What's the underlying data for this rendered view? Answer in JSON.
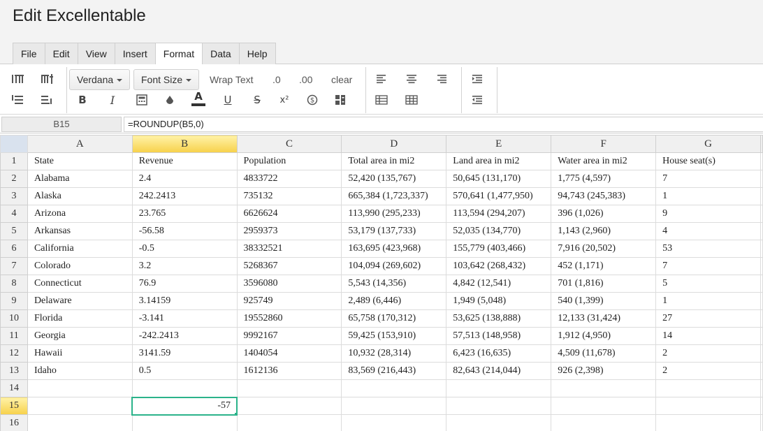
{
  "app": {
    "title": "Edit Excellentable"
  },
  "menu": {
    "tabs": [
      {
        "label": "File"
      },
      {
        "label": "Edit"
      },
      {
        "label": "View"
      },
      {
        "label": "Insert"
      },
      {
        "label": "Format"
      },
      {
        "label": "Data"
      },
      {
        "label": "Help"
      }
    ],
    "active": "Format"
  },
  "toolbar": {
    "font_family": "Verdana",
    "font_size": "Font Size",
    "wrap_text": "Wrap Text",
    "decimal_0": ".0",
    "decimal_00": ".00",
    "clear": "clear",
    "bold": "B",
    "italic": "I",
    "underline": "U",
    "strike": "S",
    "superscript": "x²",
    "text_color": "A"
  },
  "formula_bar": {
    "cell_ref": "B15",
    "formula": "=ROUNDUP(B5,0)"
  },
  "sheet": {
    "columns": [
      "A",
      "B",
      "C",
      "D",
      "E",
      "F",
      "G"
    ],
    "selected_column": "B",
    "selected_row": "15",
    "rows": [
      {
        "n": "1",
        "cells": [
          "State",
          "Revenue",
          "Population",
          "Total area in mi2",
          "Land area in mi2",
          "Water area in mi2",
          "House seat(s)"
        ]
      },
      {
        "n": "2",
        "cells": [
          "Alabama",
          "2.4",
          "4833722",
          "52,420 (135,767)",
          "50,645 (131,170)",
          "1,775 (4,597)",
          "7"
        ]
      },
      {
        "n": "3",
        "cells": [
          "Alaska",
          "242.2413",
          "735132",
          "665,384 (1,723,337)",
          "570,641 (1,477,950)",
          "94,743 (245,383)",
          "1"
        ]
      },
      {
        "n": "4",
        "cells": [
          "Arizona",
          "23.765",
          "6626624",
          "113,990 (295,233)",
          "113,594 (294,207)",
          "396 (1,026)",
          "9"
        ]
      },
      {
        "n": "5",
        "cells": [
          "Arkansas",
          "-56.58",
          "2959373",
          "53,179 (137,733)",
          "52,035 (134,770)",
          "1,143 (2,960)",
          "4"
        ]
      },
      {
        "n": "6",
        "cells": [
          "California",
          "-0.5",
          "38332521",
          "163,695 (423,968)",
          "155,779 (403,466)",
          "7,916 (20,502)",
          "53"
        ]
      },
      {
        "n": "7",
        "cells": [
          "Colorado",
          "3.2",
          "5268367",
          "104,094 (269,602)",
          "103,642 (268,432)",
          "452 (1,171)",
          "7"
        ]
      },
      {
        "n": "8",
        "cells": [
          "Connecticut",
          "76.9",
          "3596080",
          "5,543 (14,356)",
          "4,842 (12,541)",
          "701 (1,816)",
          "5"
        ]
      },
      {
        "n": "9",
        "cells": [
          "Delaware",
          "3.14159",
          "925749",
          "2,489 (6,446)",
          "1,949 (5,048)",
          "540 (1,399)",
          "1"
        ]
      },
      {
        "n": "10",
        "cells": [
          "Florida",
          "-3.141",
          "19552860",
          "65,758 (170,312)",
          "53,625 (138,888)",
          "12,133 (31,424)",
          "27"
        ]
      },
      {
        "n": "11",
        "cells": [
          "Georgia",
          "-242.2413",
          "9992167",
          "59,425 (153,910)",
          "57,513 (148,958)",
          "1,912 (4,950)",
          "14"
        ]
      },
      {
        "n": "12",
        "cells": [
          "Hawaii",
          "3141.59",
          "1404054",
          "10,932 (28,314)",
          "6,423 (16,635)",
          "4,509 (11,678)",
          "2"
        ]
      },
      {
        "n": "13",
        "cells": [
          "Idaho",
          "0.5",
          "1612136",
          "83,569 (216,443)",
          "82,643 (214,044)",
          "926 (2,398)",
          "2"
        ]
      },
      {
        "n": "14",
        "cells": [
          "",
          "",
          "",
          "",
          "",
          "",
          ""
        ]
      },
      {
        "n": "15",
        "cells": [
          "",
          "-57",
          "",
          "",
          "",
          "",
          ""
        ]
      },
      {
        "n": "16",
        "cells": [
          "",
          "",
          "",
          "",
          "",
          "",
          ""
        ]
      }
    ]
  },
  "colors": {
    "selection": "#2bb38a",
    "header_highlight": "#f7d14a"
  }
}
